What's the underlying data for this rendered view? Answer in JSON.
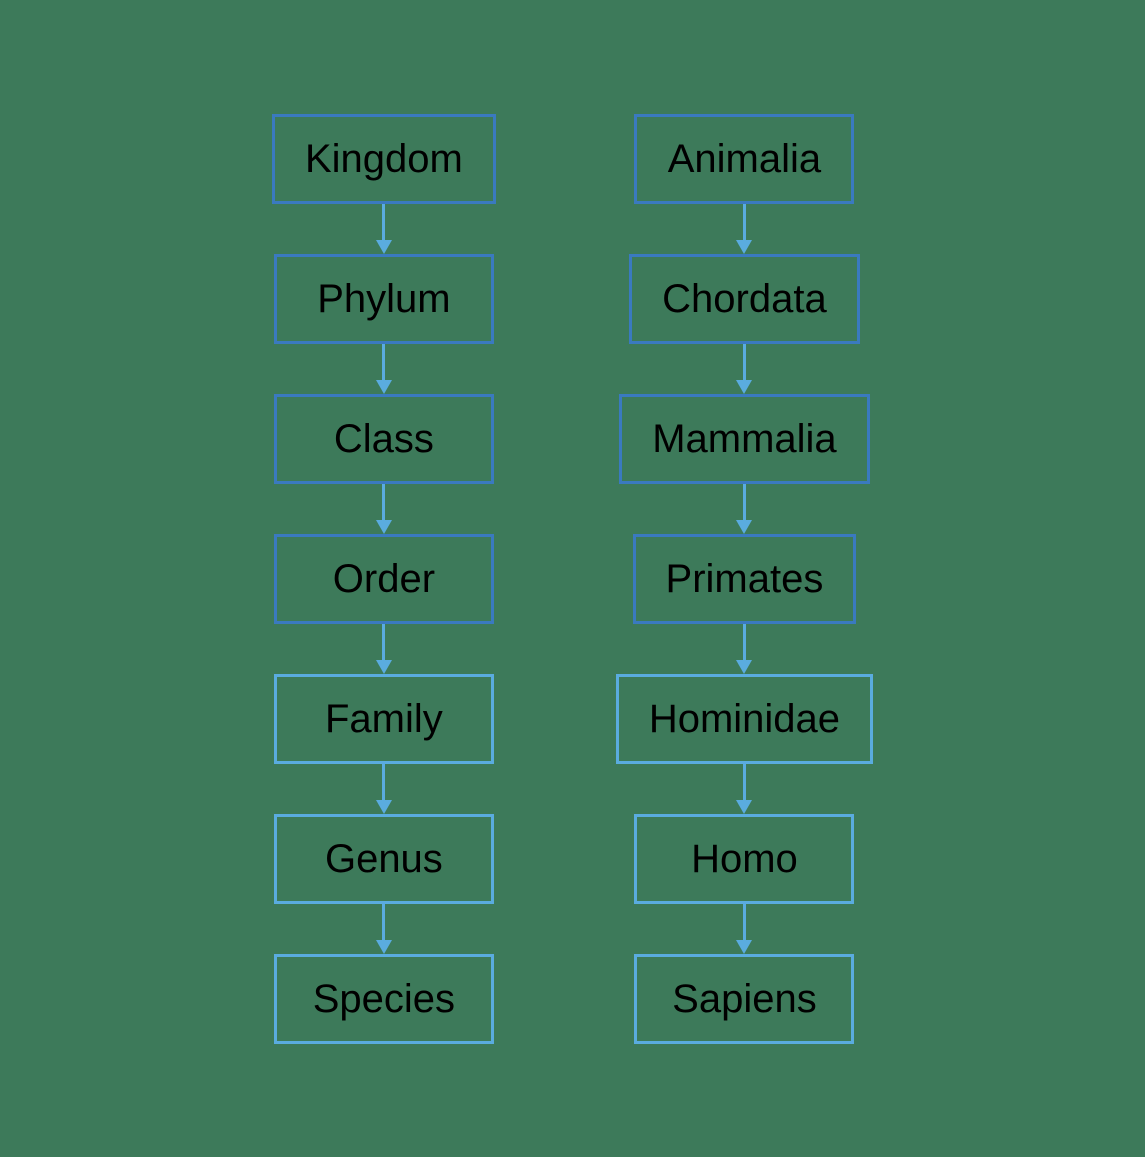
{
  "background_color": "#3d7a5a",
  "left_column": {
    "label": "left-taxonomy-column",
    "items": [
      {
        "id": "kingdom",
        "label": "Kingdom",
        "style": "dark"
      },
      {
        "id": "phylum",
        "label": "Phylum",
        "style": "dark"
      },
      {
        "id": "class",
        "label": "Class",
        "style": "dark"
      },
      {
        "id": "order",
        "label": "Order",
        "style": "dark"
      },
      {
        "id": "family",
        "label": "Family",
        "style": "light"
      },
      {
        "id": "genus",
        "label": "Genus",
        "style": "light"
      },
      {
        "id": "species",
        "label": "Species",
        "style": "light"
      }
    ]
  },
  "right_column": {
    "label": "right-taxonomy-column",
    "items": [
      {
        "id": "animalia",
        "label": "Animalia",
        "style": "dark"
      },
      {
        "id": "chordata",
        "label": "Chordata",
        "style": "dark"
      },
      {
        "id": "mammalia",
        "label": "Mammalia",
        "style": "dark"
      },
      {
        "id": "primates",
        "label": "Primates",
        "style": "dark"
      },
      {
        "id": "hominidae",
        "label": "Hominidae",
        "style": "light"
      },
      {
        "id": "homo",
        "label": "Homo",
        "style": "light"
      },
      {
        "id": "sapiens",
        "label": "Sapiens",
        "style": "light"
      }
    ]
  }
}
